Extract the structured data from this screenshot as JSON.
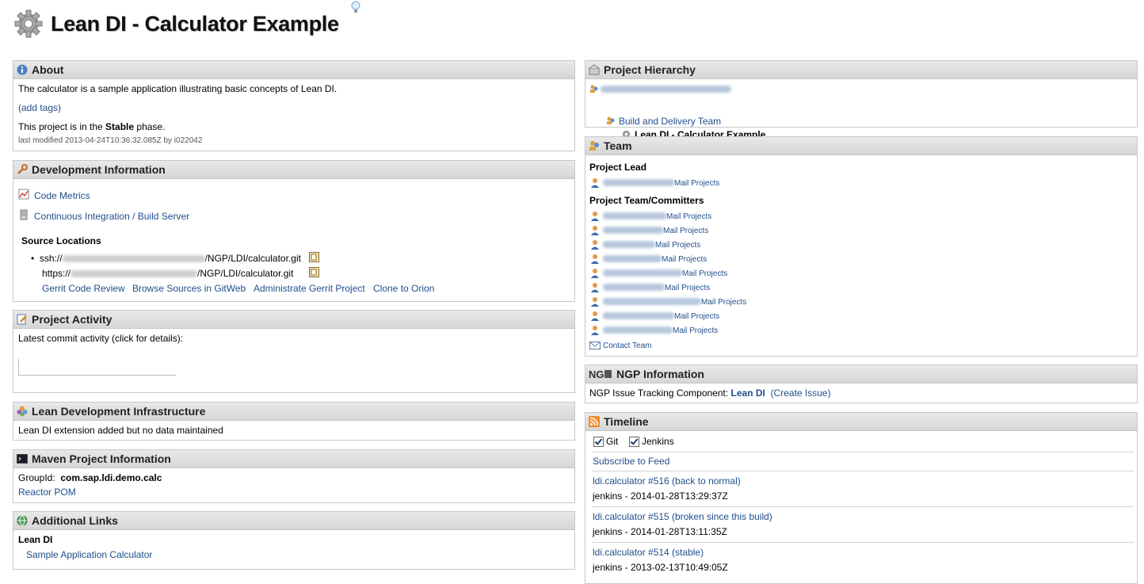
{
  "page": {
    "title": "Lean DI - Calculator Example"
  },
  "about": {
    "heading": "About",
    "description": "The calculator is a sample application illustrating basic concepts of Lean DI.",
    "add_tags": "(add tags)",
    "phase_prefix": "This project is in the ",
    "phase": "Stable",
    "phase_suffix": " phase.",
    "last_modified": "last modified 2013-04-24T10:36:32.085Z by i022042"
  },
  "dev_info": {
    "heading": "Development Information",
    "code_metrics": "Code Metrics",
    "ci_server": "Continuous Integration / Build Server",
    "source_locations": "Source Locations",
    "ssh_prefix": "ssh://",
    "ssh_suffix": "/NGP/LDI/calculator.git",
    "https_prefix": "https://",
    "https_suffix": "/NGP/LDI/calculator.git",
    "links": [
      "Gerrit Code Review",
      "Browse Sources in GitWeb",
      "Administrate Gerrit Project",
      "Clone to Orion"
    ]
  },
  "activity": {
    "heading": "Project Activity",
    "label": "Latest commit activity (click for details):"
  },
  "lean_infra": {
    "heading": "Lean Development Infrastructure",
    "text": "Lean DI extension added but no data maintained"
  },
  "maven": {
    "heading": "Maven Project Information",
    "group_label": "GroupId:",
    "group_value": "com.sap.ldi.demo.calc",
    "reactor_pom": "Reactor POM"
  },
  "additional_links": {
    "heading": "Additional Links",
    "group": "Lean DI",
    "link": "Sample Application Calculator"
  },
  "hierarchy": {
    "heading": "Project Hierarchy",
    "level2": "Build and Delivery Team",
    "current": "Lean DI - Calculator Example"
  },
  "team": {
    "heading": "Team",
    "lead_heading": "Project Lead",
    "committers_heading": "Project Team/Committers",
    "mail_projects": "Mail Projects",
    "contact_team": "Contact Team"
  },
  "ngp": {
    "heading": "NGP Information",
    "label": "NGP Issue Tracking Component:",
    "component": "Lean DI",
    "create_issue": "(Create Issue)"
  },
  "timeline": {
    "heading": "Timeline",
    "filters": [
      "Git",
      "Jenkins"
    ],
    "subscribe": "Subscribe to Feed",
    "entries": [
      {
        "title": "ldi.calculator #516 (back to normal)",
        "meta": "jenkins - 2014-01-28T13:29:37Z"
      },
      {
        "title": "ldi.calculator #515 (broken since this build)",
        "meta": "jenkins - 2014-01-28T13:11:35Z"
      },
      {
        "title": "ldi.calculator #514 (stable)",
        "meta": "jenkins - 2013-02-13T10:49:05Z"
      }
    ]
  }
}
